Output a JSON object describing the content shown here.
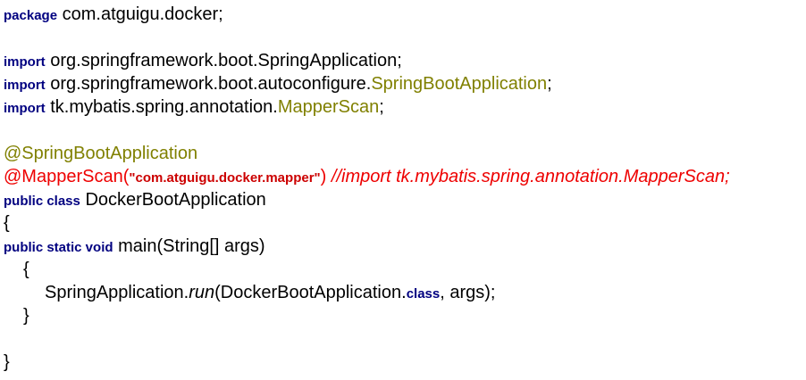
{
  "code": {
    "kw_package": "package",
    "package_name": "com.atguigu.docker",
    "semicolon": ";",
    "kw_import": "import",
    "import1": "org.springframework.boot.SpringApplication",
    "import2_prefix": "org.springframework.boot.autoconfigure.",
    "import2_class": "SpringBootApplication",
    "import3_prefix": "tk.mybatis.spring.annotation.",
    "import3_class": "MapperScan",
    "annotation1": "@SpringBootApplication",
    "annotation2": "@MapperScan(",
    "annotation2_arg": "\"com.atguigu.docker.mapper\"",
    "annotation2_close": ")",
    "comment": "//import tk.mybatis.spring.annotation.MapperScan;",
    "kw_public_class": "public class",
    "class_name": "DockerBootApplication",
    "open_brace": "{",
    "close_brace": "}",
    "kw_public_static_void": "public static void",
    "method_sig": "main(String[] args)",
    "call_class": "SpringApplication.",
    "call_method": "run",
    "call_arg_prefix": "(DockerBootApplication.",
    "kw_class": "class",
    "call_suffix": ", args);"
  }
}
